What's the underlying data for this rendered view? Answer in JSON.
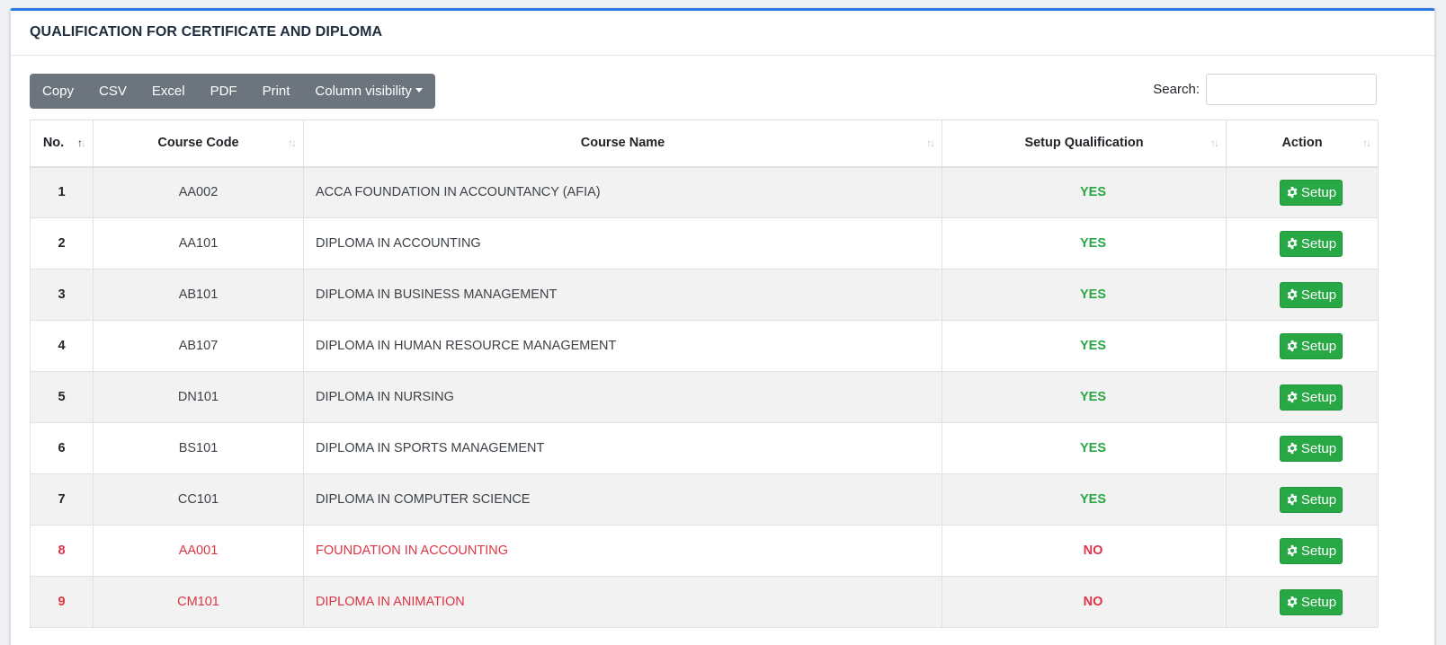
{
  "card": {
    "title": "QUALIFICATION FOR CERTIFICATE AND DIPLOMA"
  },
  "toolbar": {
    "copy": "Copy",
    "csv": "CSV",
    "excel": "Excel",
    "pdf": "PDF",
    "print": "Print",
    "column_visibility": "Column visibility"
  },
  "search": {
    "label": "Search:",
    "value": ""
  },
  "table": {
    "headers": {
      "no": "No.",
      "course_code": "Course Code",
      "course_name": "Course Name",
      "setup_qualification": "Setup Qualification",
      "action": "Action"
    },
    "action_label": "Setup",
    "rows": [
      {
        "no": "1",
        "code": "AA002",
        "name": "ACCA FOUNDATION IN ACCOUNTANCY (AFIA)",
        "setup": "YES"
      },
      {
        "no": "2",
        "code": "AA101",
        "name": "DIPLOMA IN ACCOUNTING",
        "setup": "YES"
      },
      {
        "no": "3",
        "code": "AB101",
        "name": "DIPLOMA IN BUSINESS MANAGEMENT",
        "setup": "YES"
      },
      {
        "no": "4",
        "code": "AB107",
        "name": "DIPLOMA IN HUMAN RESOURCE MANAGEMENT",
        "setup": "YES"
      },
      {
        "no": "5",
        "code": "DN101",
        "name": "DIPLOMA IN NURSING",
        "setup": "YES"
      },
      {
        "no": "6",
        "code": "BS101",
        "name": "DIPLOMA IN SPORTS MANAGEMENT",
        "setup": "YES"
      },
      {
        "no": "7",
        "code": "CC101",
        "name": "DIPLOMA IN COMPUTER SCIENCE",
        "setup": "YES"
      },
      {
        "no": "8",
        "code": "AA001",
        "name": "FOUNDATION IN ACCOUNTING",
        "setup": "NO"
      },
      {
        "no": "9",
        "code": "CM101",
        "name": "DIPLOMA IN ANIMATION",
        "setup": "NO"
      }
    ]
  },
  "colors": {
    "accent": "#2c7be5",
    "yes": "#28a745",
    "no": "#dc3545",
    "toolbar_bg": "#6c757d"
  }
}
